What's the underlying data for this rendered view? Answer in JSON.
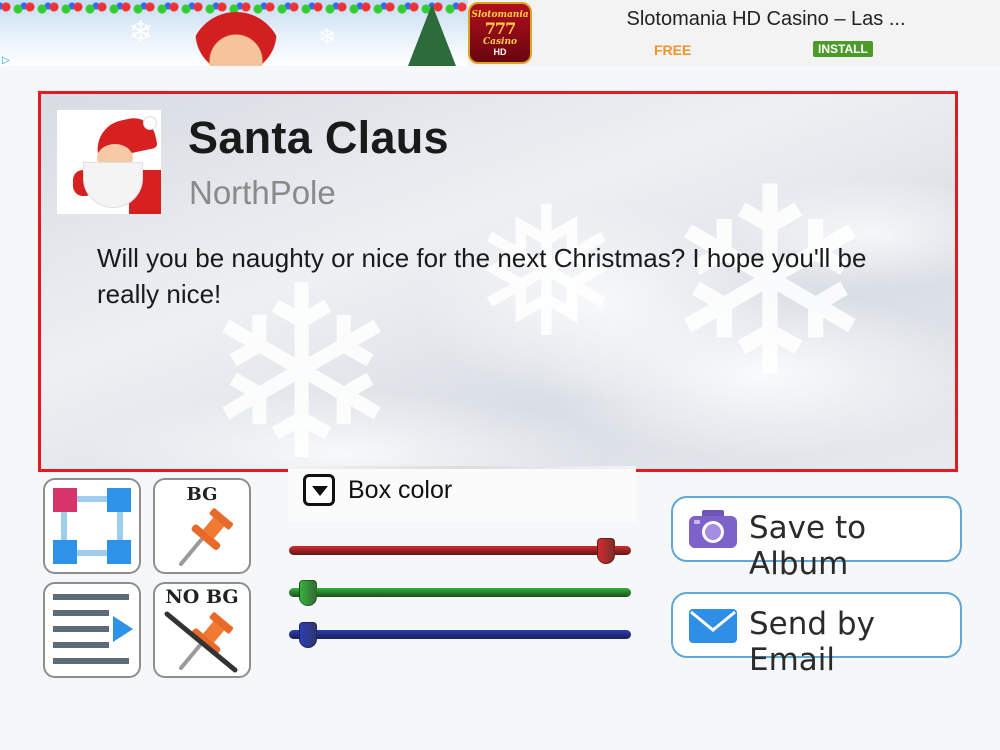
{
  "ad": {
    "title": "Slotomania HD Casino – Las ...",
    "free_label": "FREE",
    "install_label": "INSTALL",
    "icon_brand": "Slotomania",
    "icon_sevens": "777",
    "icon_sub": "Casino",
    "icon_hd": "HD",
    "choices_icon": "adchoices-icon"
  },
  "card": {
    "border_color": "#e5191f",
    "name": "Santa Claus",
    "location": "NorthPole",
    "message": "Will you be naughty or nice for the next Christmas? I hope you'll be really nice!",
    "avatar_icon": "santa-avatar"
  },
  "tools": {
    "layout_icon": "layout-nodes-icon",
    "bg_label": "BG",
    "pin_icon": "pushpin-icon",
    "align_icon": "text-align-icon",
    "no_bg_label": "NO BG",
    "no_pin_icon": "pushpin-crossed-icon"
  },
  "color_panel": {
    "label": "Box color",
    "toggle_icon": "chevron-down-icon",
    "sliders": [
      {
        "channel": "red",
        "color": "#d42a2a",
        "value": 0.95
      },
      {
        "channel": "green",
        "color": "#34b23a",
        "value": 0.03
      },
      {
        "channel": "blue",
        "color": "#2b3db8",
        "value": 0.03
      }
    ]
  },
  "actions": {
    "save_label": "Save to Album",
    "save_icon": "camera-icon",
    "email_label": "Send by Email",
    "email_icon": "envelope-icon",
    "border_color": "#5fa8d9"
  }
}
